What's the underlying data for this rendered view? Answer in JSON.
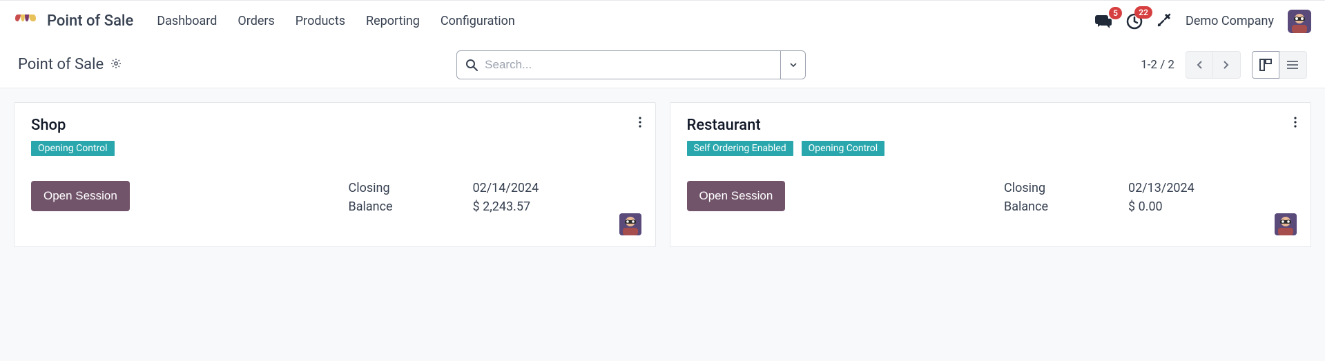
{
  "header": {
    "app_title": "Point of Sale",
    "nav": [
      "Dashboard",
      "Orders",
      "Products",
      "Reporting",
      "Configuration"
    ],
    "messages_badge": "5",
    "activities_badge": "22",
    "company": "Demo Company"
  },
  "controlbar": {
    "breadcrumb": "Point of Sale",
    "search_placeholder": "Search...",
    "page_counter": "1-2 / 2"
  },
  "cards": [
    {
      "title": "Shop",
      "tags": [
        "Opening Control"
      ],
      "open_label": "Open Session",
      "closing_label": "Closing",
      "closing_date": "02/14/2024",
      "balance_label": "Balance",
      "balance_value": "$ 2,243.57"
    },
    {
      "title": "Restaurant",
      "tags": [
        "Self Ordering Enabled",
        "Opening Control"
      ],
      "open_label": "Open Session",
      "closing_label": "Closing",
      "closing_date": "02/13/2024",
      "balance_label": "Balance",
      "balance_value": "$ 0.00"
    }
  ]
}
